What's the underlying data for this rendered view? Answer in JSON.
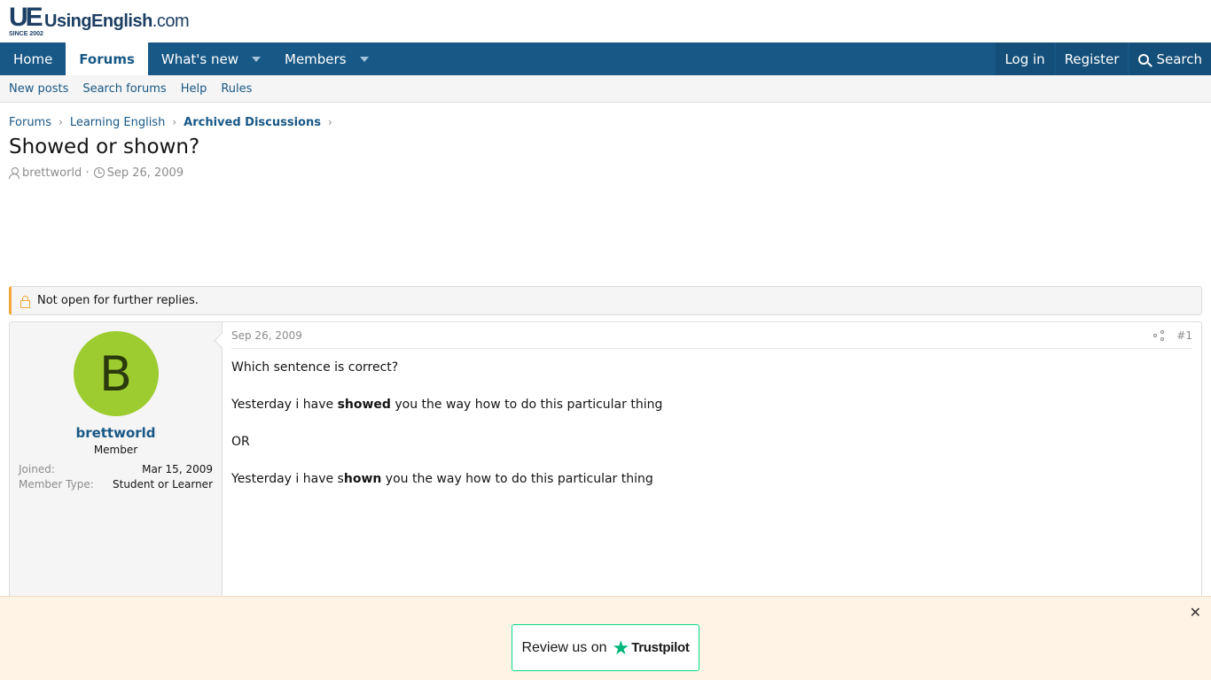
{
  "logo": {
    "mark": "UE",
    "since": "SINCE 2002",
    "name": "UsingEnglish",
    "tld": ".com"
  },
  "nav": {
    "home": "Home",
    "forums": "Forums",
    "whats_new": "What's new",
    "members": "Members",
    "login": "Log in",
    "register": "Register",
    "search": "Search"
  },
  "subnav": {
    "new_posts": "New posts",
    "search_forums": "Search forums",
    "help": "Help",
    "rules": "Rules"
  },
  "breadcrumbs": [
    "Forums",
    "Learning English",
    "Archived Discussions"
  ],
  "thread": {
    "title": "Showed or shown?",
    "author": "brettworld",
    "date": "Sep 26, 2009",
    "notice": "Not open for further replies."
  },
  "post": {
    "user": {
      "avatar_letter": "B",
      "name": "brettworld",
      "title": "Member",
      "joined_label": "Joined:",
      "joined_value": "Mar 15, 2009",
      "type_label": "Member Type:",
      "type_value": "Student or Learner"
    },
    "date": "Sep 26, 2009",
    "number": "#1",
    "lines": {
      "q": "Which sentence is correct?",
      "a_pre": "Yesterday i have ",
      "a_bold": "showed",
      "a_post": " you the way how to do this particular thing",
      "or": "OR",
      "b_pre": "Yesterday i have s",
      "b_bold": "hown",
      "b_post": " you the way how to do this particular thing"
    }
  },
  "trustpilot": {
    "close": "✕",
    "review": "Review us on",
    "star": "★",
    "brand": "Trustpilot"
  },
  "colors": {
    "nav": "#185886",
    "accent": "#185886",
    "avatar": "#9ccc2f",
    "notice": "#f2a636",
    "trustpilot_green": "#00b67a"
  }
}
